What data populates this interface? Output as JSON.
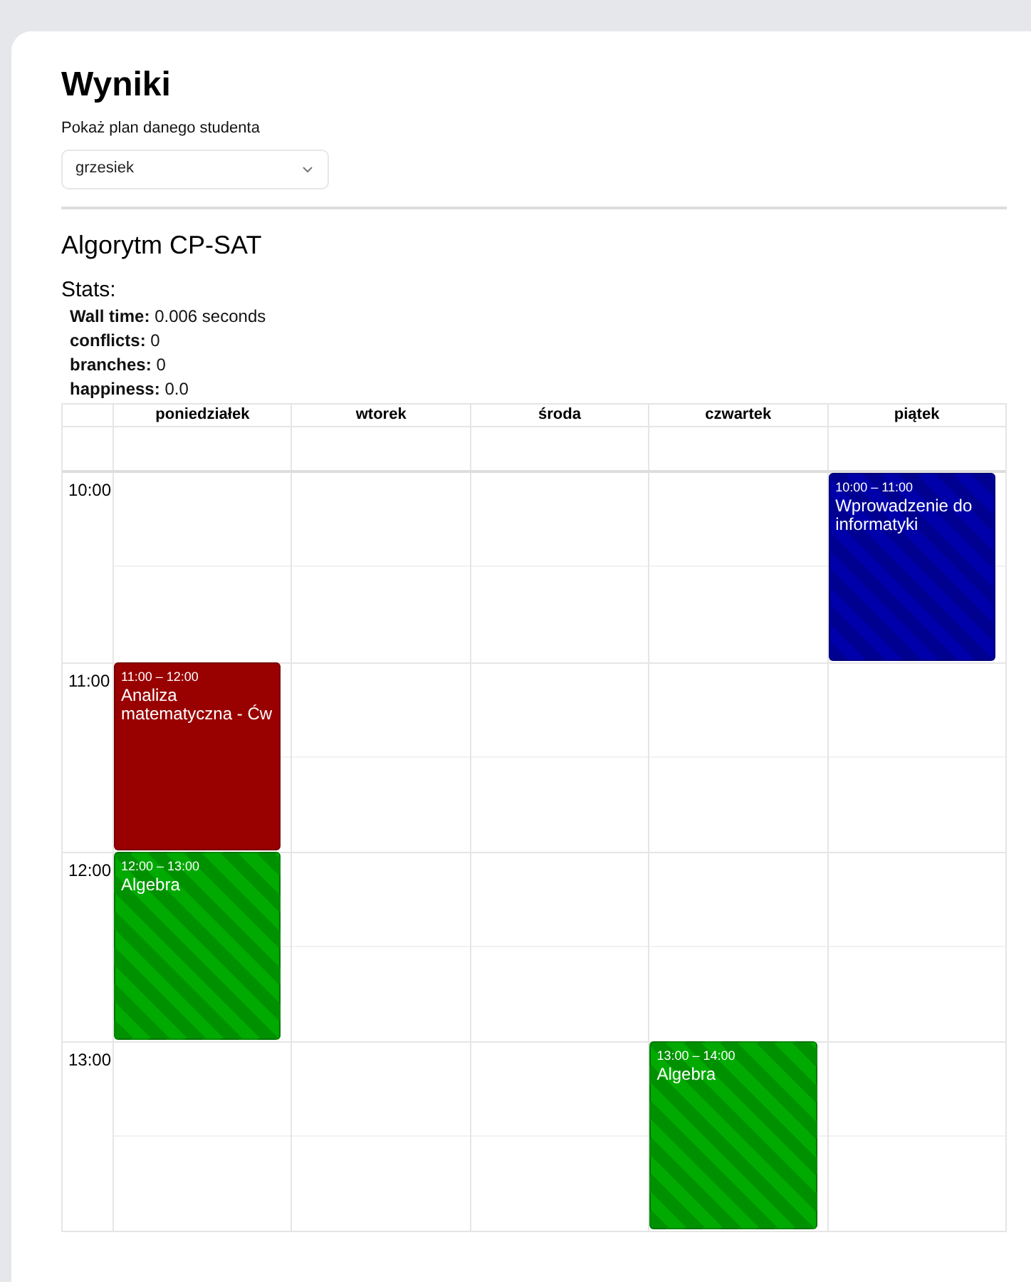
{
  "title": "Wyniki",
  "student_select": {
    "label": "Pokaż plan danego studenta",
    "value": "grzesiek"
  },
  "section": {
    "title": "Algorytm CP-SAT",
    "stats_title": "Stats:",
    "stats": [
      {
        "label": "Wall time:",
        "value": "0.006 seconds"
      },
      {
        "label": "conflicts:",
        "value": "0"
      },
      {
        "label": "branches:",
        "value": "0"
      },
      {
        "label": "happiness:",
        "value": "0.0"
      }
    ]
  },
  "calendar": {
    "hours": [
      "10:00",
      "11:00",
      "12:00",
      "13:00"
    ],
    "days": [
      {
        "name": "poniedziałek",
        "slots": [
          {
            "kind": "empty"
          },
          {
            "kind": "event",
            "time": "11:00 – 12:00",
            "title": "Analiza matematyczna - Ćw",
            "color": "#990000",
            "striped": false
          },
          {
            "kind": "event",
            "time": "12:00 – 13:00",
            "title": "Algebra",
            "color": "#00aa00",
            "striped": true
          },
          {
            "kind": "empty"
          }
        ]
      },
      {
        "name": "wtorek",
        "slots": [
          {
            "kind": "empty"
          },
          {
            "kind": "empty"
          },
          {
            "kind": "empty"
          },
          {
            "kind": "empty"
          }
        ]
      },
      {
        "name": "środa",
        "slots": [
          {
            "kind": "empty"
          },
          {
            "kind": "empty"
          },
          {
            "kind": "empty"
          },
          {
            "kind": "empty"
          }
        ]
      },
      {
        "name": "czwartek",
        "slots": [
          {
            "kind": "empty"
          },
          {
            "kind": "empty"
          },
          {
            "kind": "empty"
          },
          {
            "kind": "event",
            "time": "13:00 – 14:00",
            "title": "Algebra",
            "color": "#00aa00",
            "striped": true
          }
        ]
      },
      {
        "name": "piątek",
        "slots": [
          {
            "kind": "event",
            "time": "10:00 – 11:00",
            "title": "Wprowadzenie do informatyki",
            "color": "#0000aa",
            "striped": true
          },
          {
            "kind": "empty"
          },
          {
            "kind": "empty"
          },
          {
            "kind": "empty"
          }
        ]
      }
    ]
  }
}
